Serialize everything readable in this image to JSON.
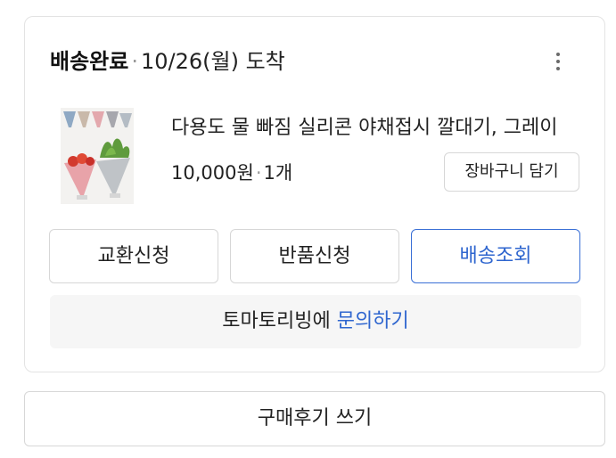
{
  "order": {
    "status": "배송완료",
    "separator": "·",
    "arrival_date": "10/26(월) 도착",
    "more_icon": "more-vertical-icon"
  },
  "product": {
    "name": "다용도 물 빠짐 실리콘 야채접시 깔대기, 그레이",
    "price": "10,000원",
    "separator": "·",
    "quantity": "1개",
    "cart_button_label": "장바구니 담기"
  },
  "actions": {
    "exchange_label": "교환신청",
    "return_label": "반품신청",
    "tracking_label": "배송조회"
  },
  "inquiry": {
    "seller": "토마토리빙에",
    "link_label": "문의하기"
  },
  "review_button_label": "구매후기 쓰기",
  "colors": {
    "accent": "#2f66cf",
    "border": "#d7d7d7",
    "inquiry_background": "#f6f6f6"
  }
}
